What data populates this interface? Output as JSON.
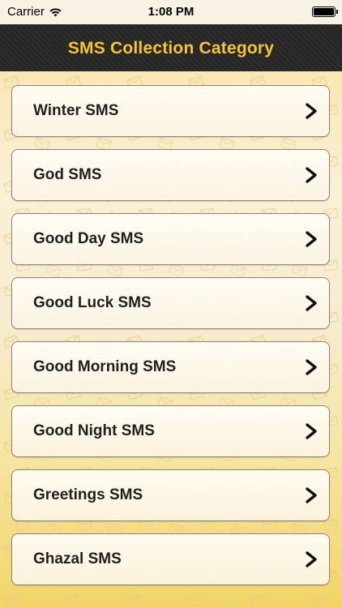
{
  "status_bar": {
    "carrier": "Carrier",
    "time": "1:08 PM",
    "wifi_icon": "wifi-icon",
    "battery_icon": "battery-icon",
    "battery_level": 1.0
  },
  "nav": {
    "title": "SMS Collection Category"
  },
  "categories": [
    {
      "label": "Winter SMS"
    },
    {
      "label": "God SMS"
    },
    {
      "label": "Good Day SMS"
    },
    {
      "label": "Good Luck SMS"
    },
    {
      "label": "Good Morning SMS"
    },
    {
      "label": "Good Night SMS"
    },
    {
      "label": "Greetings SMS"
    },
    {
      "label": "Ghazal SMS"
    }
  ],
  "icons": {
    "row_chevron": "chevron-right-icon",
    "background_pattern": "envelope-icon"
  },
  "colors": {
    "nav_background": "#262626",
    "nav_title": "#f5c533",
    "content_background": "#f3d77b"
  }
}
